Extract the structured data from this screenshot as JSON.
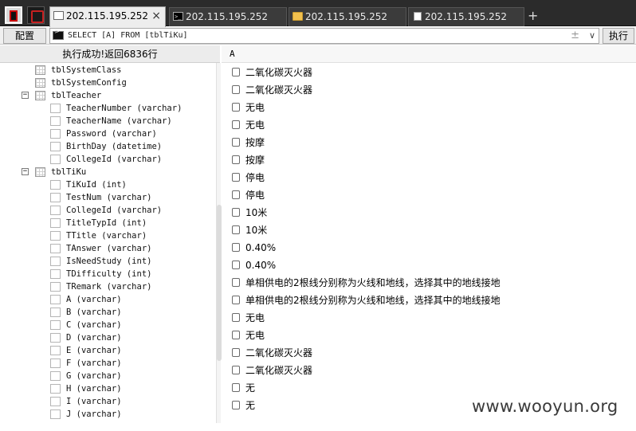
{
  "tabs": [
    {
      "label": "202.115.195.252",
      "icon": "window-icon",
      "active": true
    },
    {
      "label": "202.115.195.252",
      "icon": "terminal-icon",
      "active": false
    },
    {
      "label": "202.115.195.252",
      "icon": "folder-icon",
      "active": false
    },
    {
      "label": "202.115.195.252",
      "icon": "document-icon",
      "active": false
    }
  ],
  "tab_close_symbol": "×",
  "tab_add_symbol": "+",
  "toolbar": {
    "config_label": "配置",
    "sql": "SELECT [A] FROM [tblTiKu]",
    "sql_plus": "±",
    "sql_dropdown": "∨",
    "execute_label": "执行"
  },
  "left_header": "执行成功!返回6836行",
  "tree": [
    {
      "label": "tblSystemClass",
      "type": "table",
      "toggle": ""
    },
    {
      "label": "tblSystemConfig",
      "type": "table",
      "toggle": ""
    },
    {
      "label": "tblTeacher",
      "type": "table",
      "toggle": "−"
    },
    {
      "label": "TeacherNumber (varchar)",
      "type": "field",
      "toggle": ""
    },
    {
      "label": "TeacherName (varchar)",
      "type": "field",
      "toggle": ""
    },
    {
      "label": "Password (varchar)",
      "type": "field",
      "toggle": ""
    },
    {
      "label": "BirthDay (datetime)",
      "type": "field",
      "toggle": ""
    },
    {
      "label": "CollegeId (varchar)",
      "type": "field",
      "toggle": ""
    },
    {
      "label": "tblTiKu",
      "type": "table",
      "toggle": "−"
    },
    {
      "label": "TiKuId (int)",
      "type": "field",
      "toggle": ""
    },
    {
      "label": "TestNum (varchar)",
      "type": "field",
      "toggle": ""
    },
    {
      "label": "CollegeId (varchar)",
      "type": "field",
      "toggle": ""
    },
    {
      "label": "TitleTypId (int)",
      "type": "field",
      "toggle": ""
    },
    {
      "label": "TTitle (varchar)",
      "type": "field",
      "toggle": ""
    },
    {
      "label": "TAnswer (varchar)",
      "type": "field",
      "toggle": ""
    },
    {
      "label": "IsNeedStudy (int)",
      "type": "field",
      "toggle": ""
    },
    {
      "label": "TDifficulty (int)",
      "type": "field",
      "toggle": ""
    },
    {
      "label": "TRemark (varchar)",
      "type": "field",
      "toggle": ""
    },
    {
      "label": "A (varchar)",
      "type": "field",
      "toggle": ""
    },
    {
      "label": "B (varchar)",
      "type": "field",
      "toggle": ""
    },
    {
      "label": "C (varchar)",
      "type": "field",
      "toggle": ""
    },
    {
      "label": "D (varchar)",
      "type": "field",
      "toggle": ""
    },
    {
      "label": "E (varchar)",
      "type": "field",
      "toggle": ""
    },
    {
      "label": "F (varchar)",
      "type": "field",
      "toggle": ""
    },
    {
      "label": "G (varchar)",
      "type": "field",
      "toggle": ""
    },
    {
      "label": "H (varchar)",
      "type": "field",
      "toggle": ""
    },
    {
      "label": "I (varchar)",
      "type": "field",
      "toggle": ""
    },
    {
      "label": "J (varchar)",
      "type": "field",
      "toggle": ""
    }
  ],
  "result_column": "A",
  "results": [
    "二氧化碳灭火器",
    "二氧化碳灭火器",
    "无电",
    "无电",
    "按摩",
    "按摩",
    "停电",
    "停电",
    "10米",
    "10米",
    "0.40%",
    "0.40%",
    "单相供电的2根线分别称为火线和地线，选择其中的地线接地",
    "单相供电的2根线分别称为火线和地线，选择其中的地线接地",
    "无电",
    "无电",
    "二氧化碳灭火器",
    "二氧化碳灭火器",
    "无",
    "无"
  ],
  "watermark": "www.wooyun.org"
}
